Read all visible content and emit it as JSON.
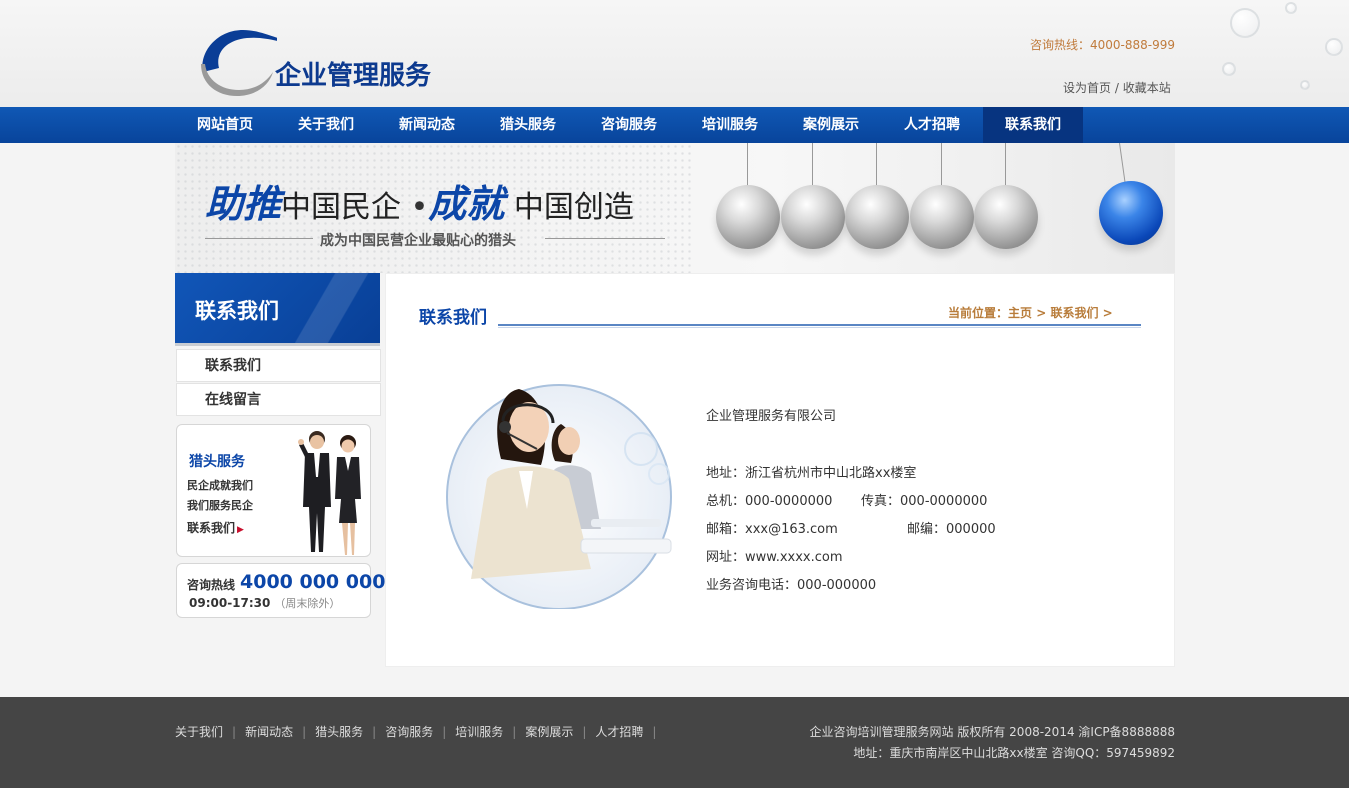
{
  "header": {
    "logo_text": "企业管理服务",
    "hotline": "咨询热线：4000-888-999",
    "set_home": "设为首页",
    "link_separator": " / ",
    "bookmark": "收藏本站"
  },
  "nav": {
    "items": [
      "网站首页",
      "关于我们",
      "新闻动态",
      "猎头服务",
      "咨询服务",
      "培训服务",
      "案例展示",
      "人才招聘",
      "联系我们"
    ],
    "active_index": 8
  },
  "banner": {
    "word1": "助推",
    "text1": "中国民企",
    "dot": "•",
    "word2": "成就",
    "text2": "中国创造",
    "subtitle": "成为中国民营企业最贴心的猎头"
  },
  "sidebar": {
    "title": "联系我们",
    "menu": [
      "联系我们",
      "在线留言"
    ],
    "promo": {
      "title": "猎头服务",
      "line1": "民企成就我们",
      "line2": "我们服务民企",
      "link": "联系我们"
    },
    "hotline": {
      "label": "咨询热线",
      "number": "4000 000 000",
      "hours": "09:00-17:30",
      "note": "（周末除外）"
    }
  },
  "content": {
    "title": "联系我们",
    "breadcrumb": {
      "prefix": "当前位置：",
      "home": "主页",
      "sep1": " > ",
      "current": "联系我们",
      "sep2": " >"
    },
    "company": "企业管理服务有限公司",
    "address": "地址：浙江省杭州市中山北路xx楼室",
    "phone": "总机：000-0000000",
    "fax": "传真：000-0000000",
    "email": "邮箱：xxx@163.com",
    "postcode": "邮编：000000",
    "website": "网址：www.xxxx.com",
    "consult_phone": "业务咨询电话：000-000000"
  },
  "footer": {
    "links": [
      "关于我们",
      "新闻动态",
      "猎头服务",
      "咨询服务",
      "培训服务",
      "案例展示",
      "人才招聘"
    ],
    "separator": "|",
    "copyright": "企业咨询培训管理服务网站 版权所有 2008-2014 渝ICP备8888888",
    "address": "地址：重庆市南岸区中山北路xx楼室 咨询QQ：597459892"
  },
  "colors": {
    "nav_blue": "#08449b",
    "accent_blue": "#0c46a8",
    "accent_gold": "#b87c3a",
    "footer_bg": "#454545"
  }
}
